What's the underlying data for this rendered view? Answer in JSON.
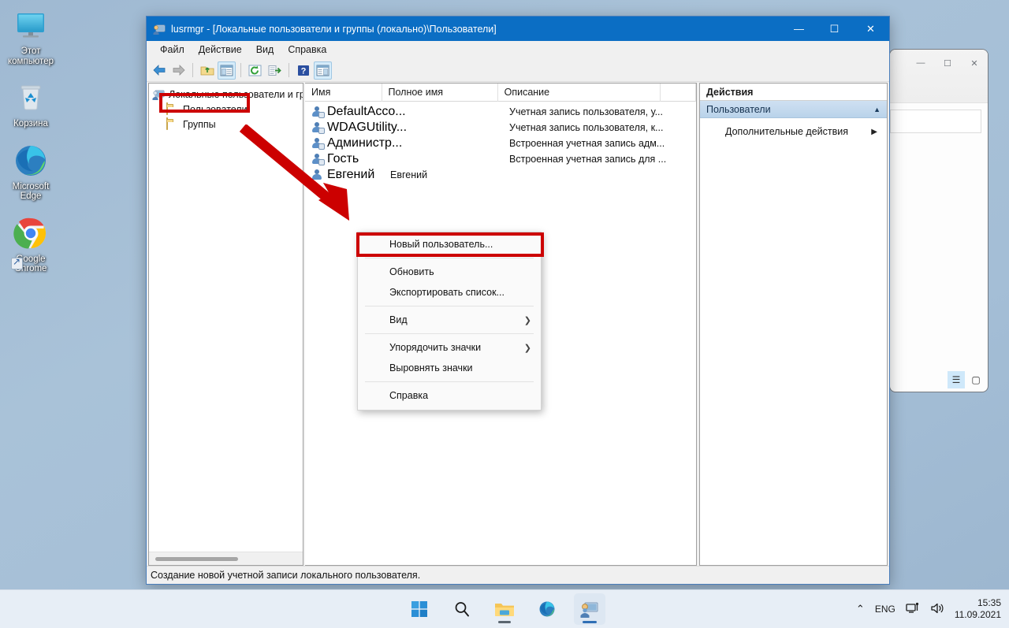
{
  "desktop": {
    "icons": [
      {
        "name": "this-pc",
        "label": "Этот компьютер",
        "icon": "monitor-icon",
        "shortcut": false
      },
      {
        "name": "recycle-bin",
        "label": "Корзина",
        "icon": "recycle-bin-icon",
        "shortcut": false
      },
      {
        "name": "microsoft-edge",
        "label": "Microsoft Edge",
        "icon": "edge-icon",
        "shortcut": true
      },
      {
        "name": "google-chrome",
        "label": "Google Chrome",
        "icon": "chrome-icon",
        "shortcut": true
      }
    ]
  },
  "window": {
    "title": "lusrmgr - [Локальные пользователи и группы (локально)\\Пользователи]",
    "icon": "lusrmgr-icon",
    "controls": {
      "minimize": "—",
      "maximize": "☐",
      "close": "✕"
    },
    "menu": [
      {
        "name": "menu-file",
        "label": "Файл"
      },
      {
        "name": "menu-action",
        "label": "Действие"
      },
      {
        "name": "menu-view",
        "label": "Вид"
      },
      {
        "name": "menu-help",
        "label": "Справка"
      }
    ],
    "toolbar": [
      {
        "name": "back-button",
        "icon": "arrow-left-icon",
        "pressed": false
      },
      {
        "name": "forward-button",
        "icon": "arrow-right-icon",
        "pressed": false
      },
      {
        "name": "up-one-level-button",
        "icon": "folder-up-icon",
        "pressed": false
      },
      {
        "name": "show-hide-tree-button",
        "icon": "console-tree-icon",
        "pressed": true
      },
      {
        "name": "refresh-button",
        "icon": "refresh-icon",
        "pressed": false
      },
      {
        "name": "export-list-button",
        "icon": "export-list-icon",
        "pressed": false
      },
      {
        "name": "help-button",
        "icon": "question-mark-icon",
        "pressed": false
      },
      {
        "name": "show-hide-action-pane-button",
        "icon": "action-pane-icon",
        "pressed": true
      }
    ]
  },
  "tree": {
    "root": {
      "label": "Локальные пользователи и гр",
      "icon": "computer-icon"
    },
    "nodes": [
      {
        "name": "tree-node-users",
        "label": "Пользователи",
        "icon": "folder-icon",
        "selected": true
      },
      {
        "name": "tree-node-groups",
        "label": "Группы",
        "icon": "folder-icon",
        "selected": false
      }
    ]
  },
  "list": {
    "columns": [
      "Имя",
      "Полное имя",
      "Описание",
      ""
    ],
    "rows": [
      {
        "name": "DefaultAcco...",
        "full_name": "",
        "description": "Учетная запись пользователя, у..."
      },
      {
        "name": "WDAGUtility...",
        "full_name": "",
        "description": "Учетная запись пользователя, к..."
      },
      {
        "name": "Администр...",
        "full_name": "",
        "description": "Встроенная учетная запись адм..."
      },
      {
        "name": "Гость",
        "full_name": "",
        "description": "Встроенная учетная запись для ..."
      },
      {
        "name": "Евгений",
        "full_name": "Евгений",
        "description": ""
      }
    ]
  },
  "actions": {
    "title": "Действия",
    "group": {
      "label": "Пользователи",
      "collapse_icon": "chevron-up-icon"
    },
    "items": [
      {
        "name": "action-more-actions",
        "label": "Дополнительные действия",
        "submenu_icon": "chevron-right-icon"
      }
    ]
  },
  "context_menu": {
    "items": [
      {
        "name": "ctx-new-user",
        "label": "Новый пользователь...",
        "highlighted": true,
        "submenu": false
      },
      {
        "separator": true
      },
      {
        "name": "ctx-refresh",
        "label": "Обновить",
        "submenu": false
      },
      {
        "name": "ctx-export-list",
        "label": "Экспортировать список...",
        "submenu": false
      },
      {
        "separator": true
      },
      {
        "name": "ctx-view",
        "label": "Вид",
        "submenu": true,
        "submenu_icon": "chevron-right-icon"
      },
      {
        "separator": true
      },
      {
        "name": "ctx-arrange-icons",
        "label": "Упорядочить значки",
        "submenu": true,
        "submenu_icon": "chevron-right-icon"
      },
      {
        "name": "ctx-align-icons",
        "label": "Выровнять значки",
        "submenu": false
      },
      {
        "separator": true
      },
      {
        "name": "ctx-help",
        "label": "Справка",
        "submenu": false
      }
    ]
  },
  "statusbar": {
    "text": "Создание новой учетной записи локального пользователя."
  },
  "taskbar": {
    "buttons": [
      {
        "name": "start-button",
        "icon": "windows-logo-icon",
        "active": false,
        "indicator": false
      },
      {
        "name": "search-button",
        "icon": "search-icon",
        "active": false,
        "indicator": false
      },
      {
        "name": "file-explorer-button",
        "icon": "folder-icon",
        "active": false,
        "indicator": true
      },
      {
        "name": "edge-button",
        "icon": "edge-icon",
        "active": false,
        "indicator": false
      },
      {
        "name": "lusrmgr-button",
        "icon": "lusrmgr-icon",
        "active": true,
        "indicator": true
      }
    ],
    "tray": {
      "overflow_icon": "chevron-up-icon",
      "language": "ENG",
      "network_icon": "network-icon",
      "volume_icon": "volume-icon",
      "time": "15:35",
      "date": "11.09.2021"
    }
  },
  "colors": {
    "titlebar": "#0b6ec4",
    "annotation_red": "#cc0000",
    "desktop": "#a4bed6",
    "taskbar": "#e7eef6"
  }
}
